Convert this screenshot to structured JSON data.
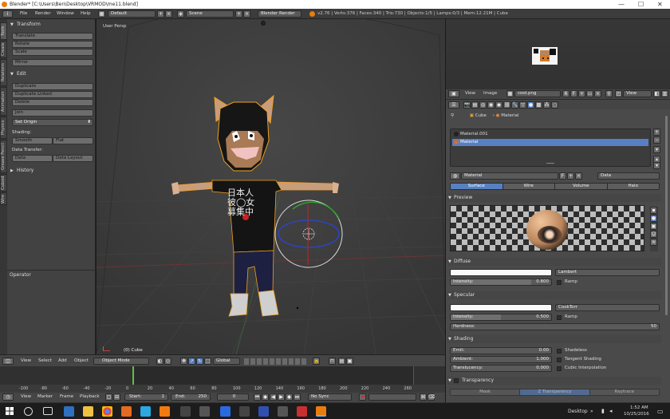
{
  "window": {
    "title": "Blender* [C:\\Users\\Ben\\Desktop\\VRMOD\\me11.blend]",
    "minimize": "—",
    "maximize": "☐",
    "close": "✕"
  },
  "infobar": {
    "menus": [
      "File",
      "Render",
      "Window",
      "Help"
    ],
    "screen_layout": "Default",
    "scene": "Scene",
    "render_engine": "Blender Render",
    "stats": "v2.76 | Verts:376 | Faces:340 | Tris:730 | Objects:1/5 | Lamps:0/3 | Mem:12.21M | Cube"
  },
  "toolshelf": {
    "vertical_tabs": [
      "Tools",
      "Create",
      "Relations",
      "Animation",
      "Physics",
      "Grease Pencil",
      "Cuboid",
      "Wire"
    ],
    "transform_title": "Transform",
    "translate": "Translate",
    "rotate": "Rotate",
    "scale": "Scale",
    "mirror": "Mirror",
    "edit_title": "Edit",
    "duplicate": "Duplicate",
    "duplicate_linked": "Duplicate Linked",
    "delete": "Delete",
    "join": "Join",
    "set_origin": "Set Origin",
    "shading_label": "Shading:",
    "smooth": "Smooth",
    "flat": "Flat",
    "data_transfer_label": "Data Transfer:",
    "data": "Data",
    "data_layout": "Data Layout",
    "history_title": "History",
    "operator_title": "Operator"
  },
  "viewport": {
    "view_name": "User Persp",
    "object_label": "(0) Cube",
    "character_text": "日本人\n彼◯女\n募集中"
  },
  "viewport_header": {
    "menus": [
      "View",
      "Select",
      "Add",
      "Object"
    ],
    "mode": "Object Mode",
    "orientation": "Global"
  },
  "timeline": {
    "ruler_ticks": [
      "-100",
      "-80",
      "-60",
      "-40",
      "-20",
      "0",
      "20",
      "40",
      "60",
      "80",
      "100",
      "120",
      "140",
      "160",
      "180",
      "200",
      "220",
      "240",
      "260"
    ],
    "menus": [
      "View",
      "Marker",
      "Frame",
      "Playback"
    ],
    "start_label": "Start:",
    "start_value": "1",
    "end_label": "End:",
    "end_value": "250",
    "current_frame": "0",
    "sync": "No Sync"
  },
  "image_editor": {
    "menus": [
      "View",
      "Image"
    ],
    "image_name": "cool.png",
    "users": "6",
    "view_mode": "View"
  },
  "properties": {
    "breadcrumb": [
      "Cube",
      "Material"
    ],
    "material_slots": [
      "Material.001",
      "Material"
    ],
    "active_slot": "Material",
    "material_name": "Material",
    "fake_user": "F",
    "link": "Data",
    "tabs": [
      "Surface",
      "Wire",
      "Volume",
      "Halo"
    ],
    "active_tab": "Surface",
    "preview_title": "Preview",
    "diffuse_title": "Diffuse",
    "diffuse_shader": "Lambert",
    "diffuse_intensity_label": "Intensity:",
    "diffuse_intensity": "0.800",
    "diffuse_intensity_level": 0.8,
    "ramp": "Ramp",
    "specular_title": "Specular",
    "specular_shader": "CookTorr",
    "specular_intensity_label": "Intensity:",
    "specular_intensity": "0.500",
    "specular_intensity_level": 0.5,
    "hardness_label": "Hardness:",
    "hardness": "50",
    "shading_title": "Shading",
    "emit_label": "Emit:",
    "emit": "0.00",
    "ambient_label": "Ambient:",
    "ambient": "1.000",
    "translucency_label": "Translucency:",
    "translucency": "0.000",
    "shadeless": "Shadeless",
    "tangent_shading": "Tangent Shading",
    "cubic_interpolation": "Cubic Interpolation",
    "transparency_title": "Transparency",
    "transparency_modes": [
      "Mask",
      "Z Transparency",
      "Raytrace"
    ],
    "active_transparency_mode": "Z Transparency"
  },
  "taskbar": {
    "desktop_label": "Desktop",
    "time": "1:52 AM",
    "date": "10/25/2016"
  },
  "colors": {
    "accent_blue": "#5680c2",
    "blender_orange": "#e87d0d"
  }
}
